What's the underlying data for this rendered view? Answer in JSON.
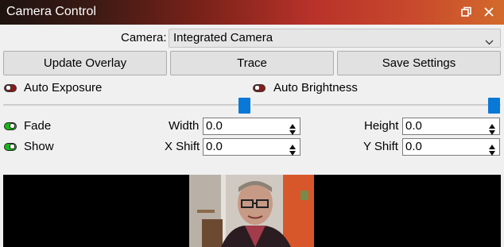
{
  "window": {
    "title": "Camera Control",
    "buttons": {
      "restore_icon": "restore-icon",
      "close_icon": "close-icon"
    }
  },
  "camera": {
    "label": "Camera:",
    "selected": "Integrated Camera"
  },
  "actions": {
    "update_overlay": "Update Overlay",
    "trace": "Trace",
    "save_settings": "Save Settings"
  },
  "toggles": {
    "auto_exposure": {
      "label": "Auto Exposure",
      "state": "off"
    },
    "auto_brightness": {
      "label": "Auto Brightness",
      "state": "off"
    },
    "fade": {
      "label": "Fade",
      "state": "on"
    },
    "show": {
      "label": "Show",
      "state": "on"
    }
  },
  "sliders": {
    "exposure_level": 1.0,
    "brightness_level": 1.0
  },
  "fields": {
    "width": {
      "label": "Width",
      "value": "0.0"
    },
    "height": {
      "label": "Height",
      "value": "0.0"
    },
    "x_shift": {
      "label": "X Shift",
      "value": "0.0"
    },
    "y_shift": {
      "label": "Y Shift",
      "value": "0.0"
    }
  },
  "colors": {
    "accent": "#0a78d7",
    "toggle_on": "#16b816",
    "toggle_off": "#8b1a1a"
  }
}
